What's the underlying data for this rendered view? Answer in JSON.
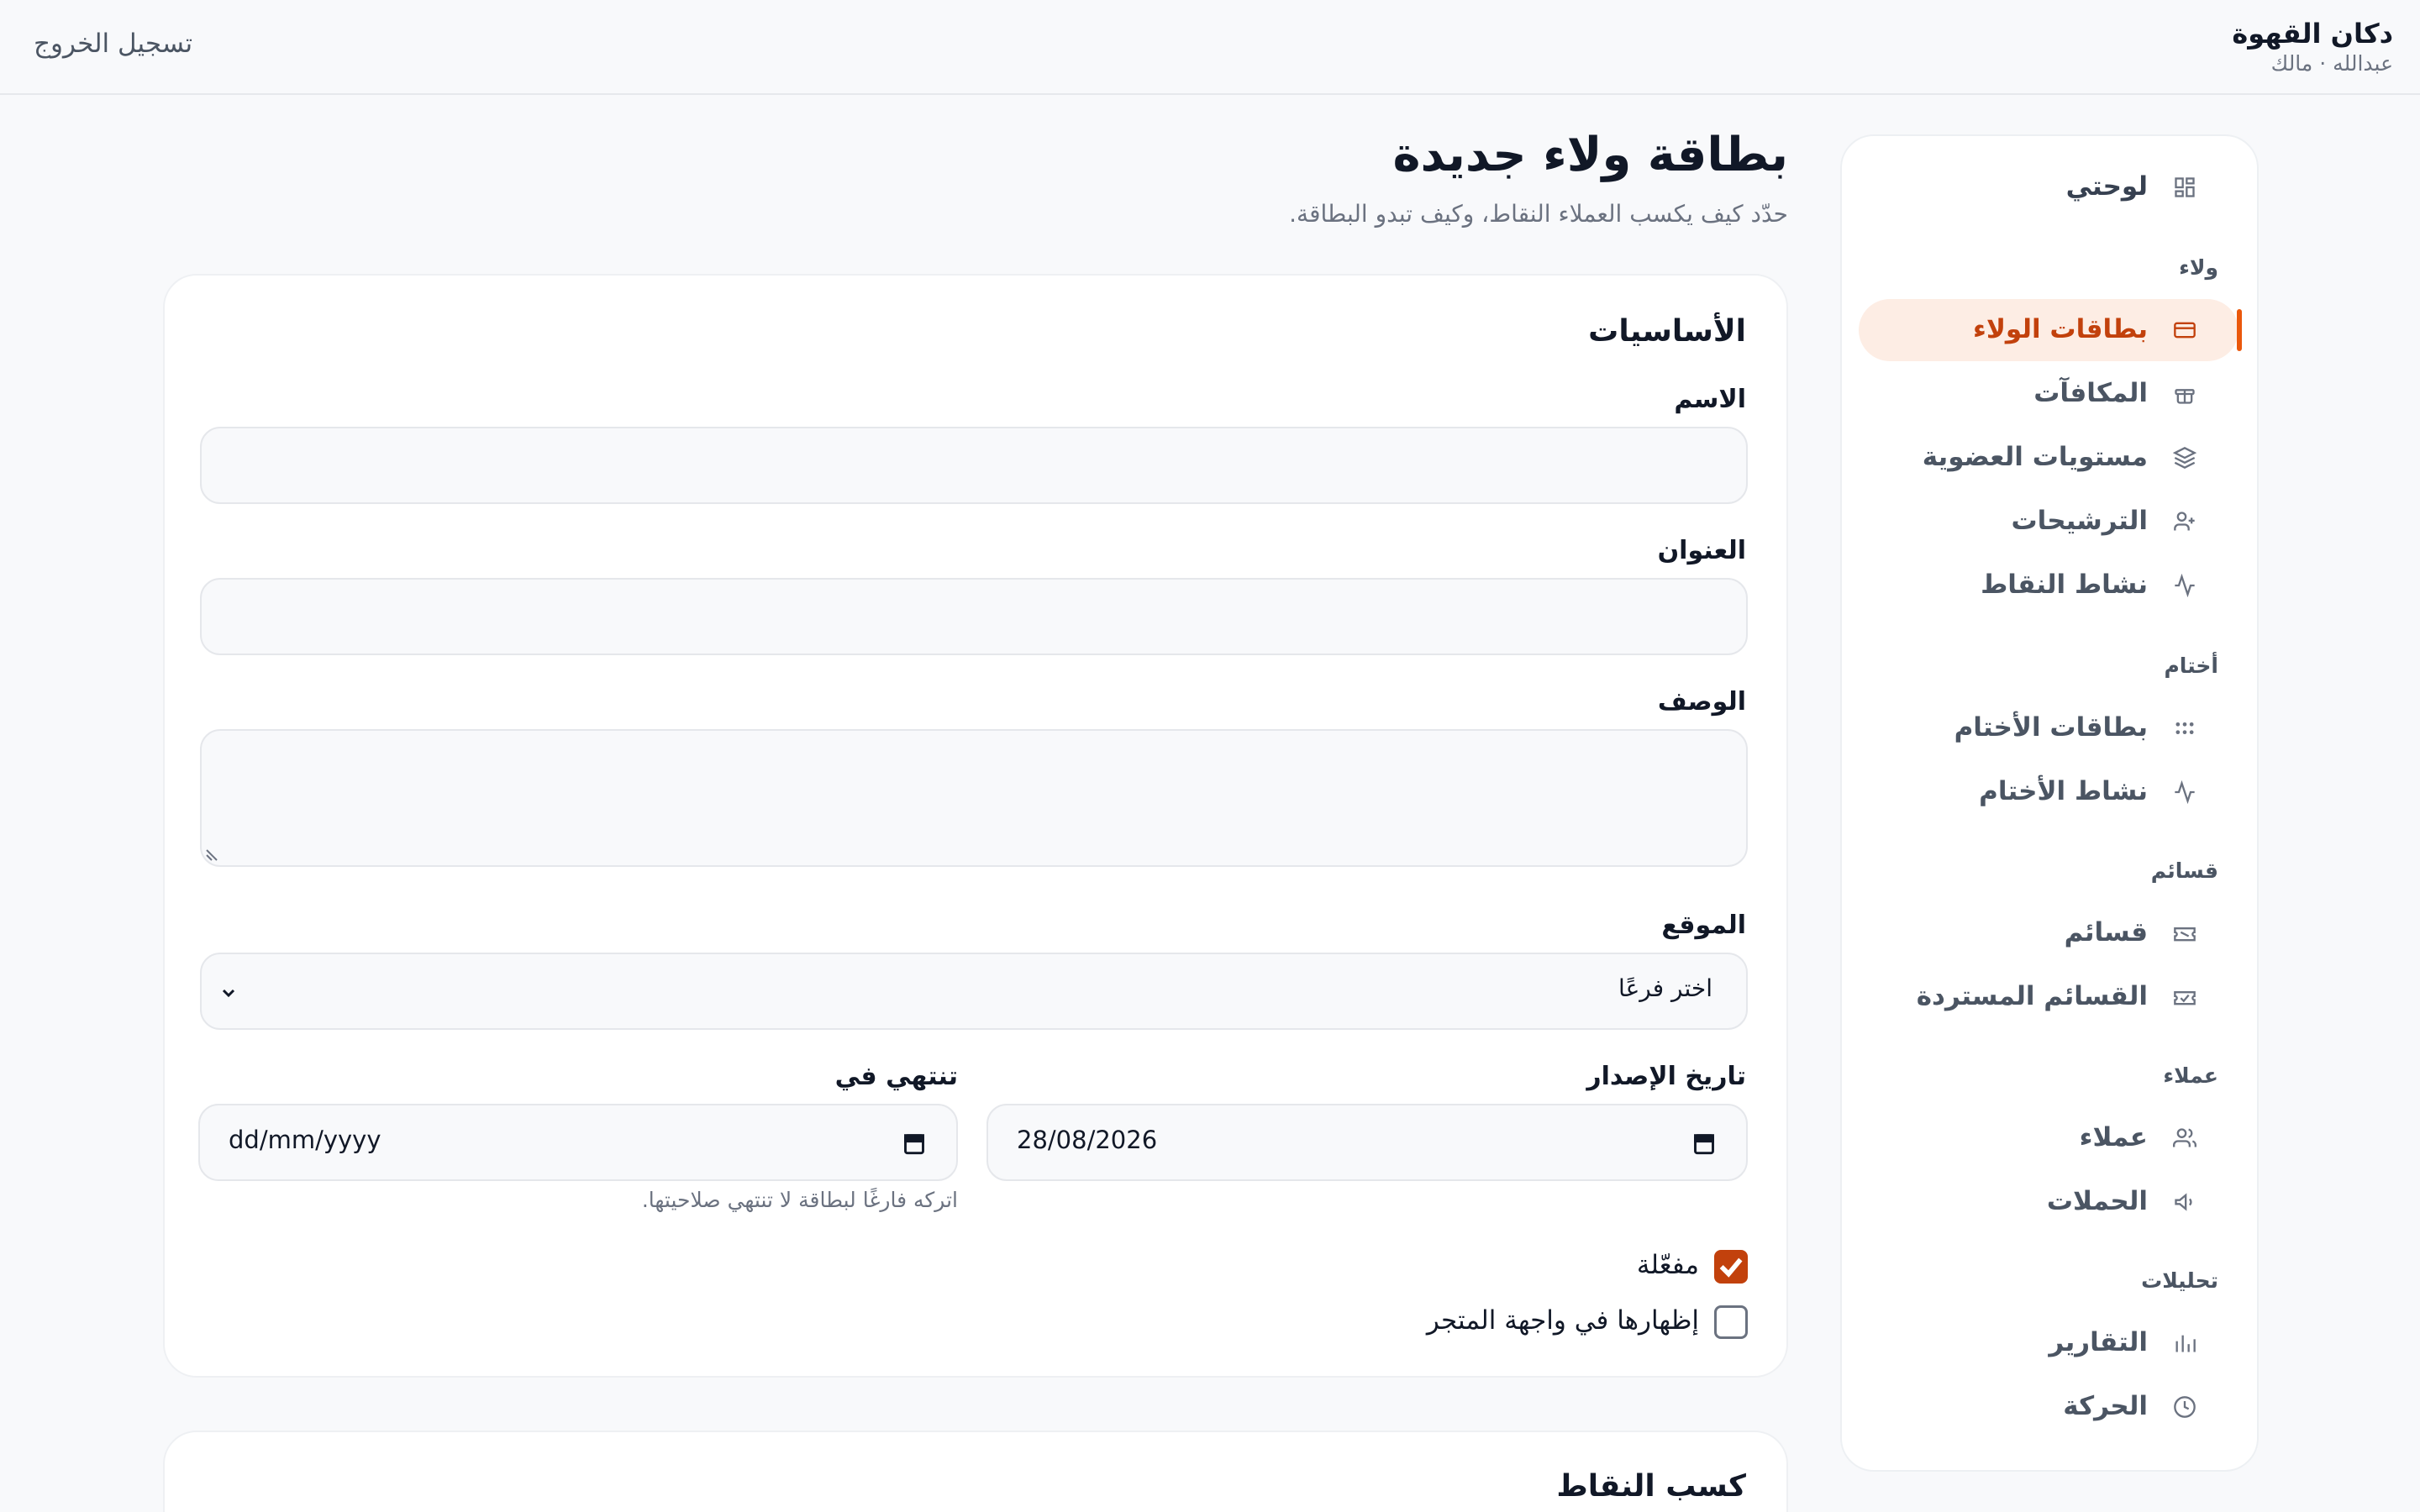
{
  "topbar": {
    "brand_name": "دكان القهوة",
    "brand_user": "عبدالله · مالك",
    "logout_label": "تسجيل الخروج"
  },
  "sidebar": {
    "dashboard_label": "لوحتي",
    "sections": {
      "loyalty": "ولاء",
      "stamps": "أختام",
      "vouchers": "قسائم",
      "customers": "عملاء",
      "analytics": "تحليلات"
    },
    "items": {
      "loyalty_cards": "بطاقات الولاء",
      "rewards": "المكافآت",
      "membership_tiers": "مستويات العضوية",
      "referrals": "الترشيحات",
      "points_activity": "نشاط النقاط",
      "stamp_cards": "بطاقات الأختام",
      "stamp_activity": "نشاط الأختام",
      "vouchers": "قسائم",
      "redeemed_vouchers": "القسائم المستردة",
      "customers": "عملاء",
      "campaigns": "الحملات",
      "reports": "التقارير",
      "traffic": "الحركة"
    }
  },
  "main": {
    "title": "بطاقة ولاء جديدة",
    "subtitle": "حدّد كيف يكسب العملاء النقاط، وكيف تبدو البطاقة.",
    "basics_title": "الأساسيات",
    "name_label": "الاسم",
    "name_value": "",
    "heading_label": "العنوان",
    "heading_value": "",
    "description_label": "الوصف",
    "description_value": "",
    "location_label": "الموقع",
    "location_selected": "اختر فرعًا",
    "issue_date_label": "تاريخ الإصدار",
    "issue_date_value": "28/08/2026",
    "expires_label": "تنتهي في",
    "expires_value": "dd/mm/yyyy",
    "expires_hint": "اتركه فارغًا لبطاقة لا تنتهي صلاحيتها.",
    "active_label": "مفعّلة",
    "active_checked": true,
    "storefront_label": "إظهارها في واجهة المتجر",
    "storefront_checked": false,
    "earning_title": "كسب النقاط"
  },
  "colors": {
    "accent": "#c2410c",
    "accent_bg": "#fdede4",
    "text_muted": "#6b7280"
  },
  "icons": {
    "dashboard": "dashboard-icon",
    "card": "card-icon",
    "gift": "gift-icon",
    "layers": "layers-icon",
    "user_plus": "user-plus-icon",
    "activity": "activity-icon",
    "grid_dots": "grid-dots-icon",
    "ticket": "ticket-icon",
    "users": "users-icon",
    "megaphone": "megaphone-icon",
    "bar_chart": "bar-chart-icon",
    "clock": "clock-icon",
    "calendar": "calendar-icon",
    "chevron": "chevron-down-icon"
  }
}
